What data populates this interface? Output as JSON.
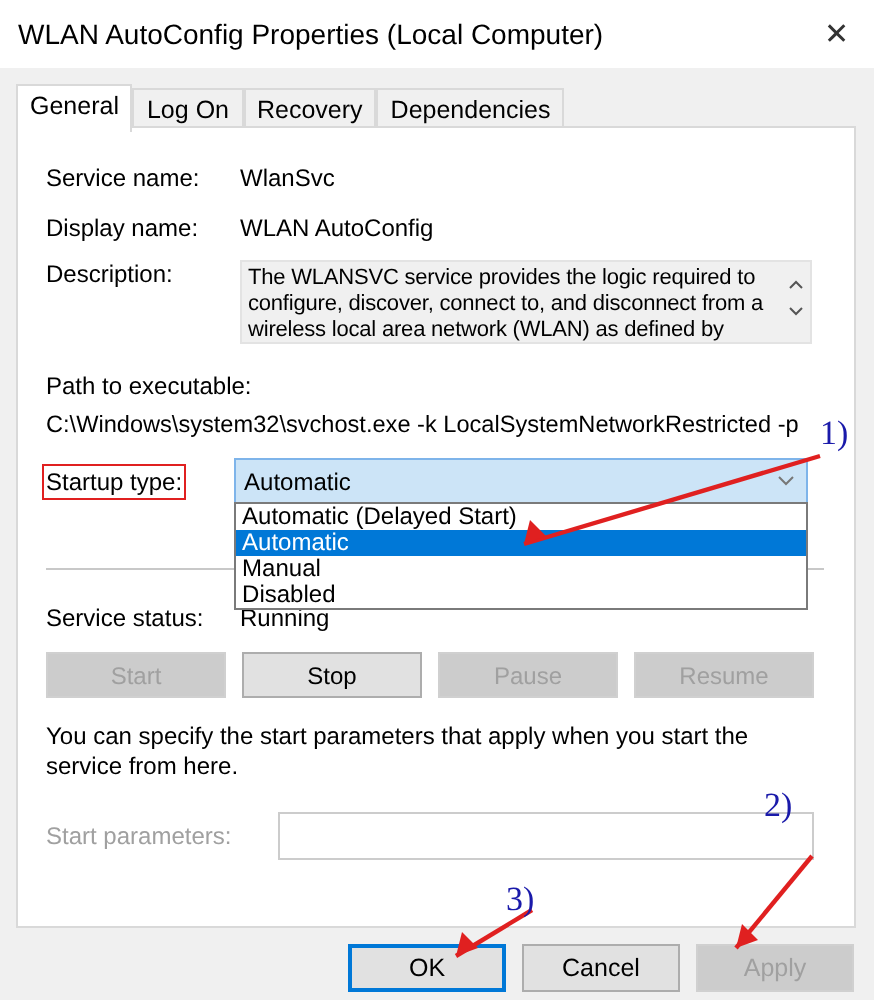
{
  "window": {
    "title": "WLAN AutoConfig Properties (Local Computer)",
    "close": "✕"
  },
  "tabs": [
    {
      "label": "General",
      "selected": true
    },
    {
      "label": "Log On",
      "selected": false
    },
    {
      "label": "Recovery",
      "selected": false
    },
    {
      "label": "Dependencies",
      "selected": false
    }
  ],
  "info": [
    {
      "label": "Service name:",
      "value": "WlanSvc"
    },
    {
      "label": "Display name:",
      "value": "WLAN AutoConfig"
    }
  ],
  "description": {
    "label": "Description:",
    "text": "The WLANSVC service provides the logic required to configure, discover, connect to, and disconnect from a wireless local area network (WLAN) as defined by"
  },
  "path": {
    "label": "Path to executable:",
    "value": "C:\\Windows\\system32\\svchost.exe -k LocalSystemNetworkRestricted -p"
  },
  "startup": {
    "label": "Startup type:",
    "highlighted": true,
    "value": "Automatic",
    "expanded": true,
    "options": [
      {
        "label": "Automatic (Delayed Start)",
        "selected": false
      },
      {
        "label": "Automatic",
        "selected": true
      },
      {
        "label": "Manual",
        "selected": false
      },
      {
        "label": "Disabled",
        "selected": false
      }
    ]
  },
  "status": {
    "label": "Service status:",
    "value": "Running"
  },
  "service_buttons": [
    {
      "label": "Start",
      "disabled": true
    },
    {
      "label": "Stop",
      "disabled": false
    },
    {
      "label": "Pause",
      "disabled": true
    },
    {
      "label": "Resume",
      "disabled": true
    }
  ],
  "hint": "You can specify the start parameters that apply when you start the service from here.",
  "start_parameters": {
    "label": "Start parameters:",
    "disabled": true
  },
  "buttons": [
    {
      "label": "OK",
      "disabled": false,
      "focused": true
    },
    {
      "label": "Cancel",
      "disabled": false,
      "focused": false
    },
    {
      "label": "Apply",
      "disabled": true,
      "focused": false
    }
  ],
  "annotations": [
    {
      "label": "1)"
    },
    {
      "label": "2)"
    },
    {
      "label": "3)"
    }
  ]
}
